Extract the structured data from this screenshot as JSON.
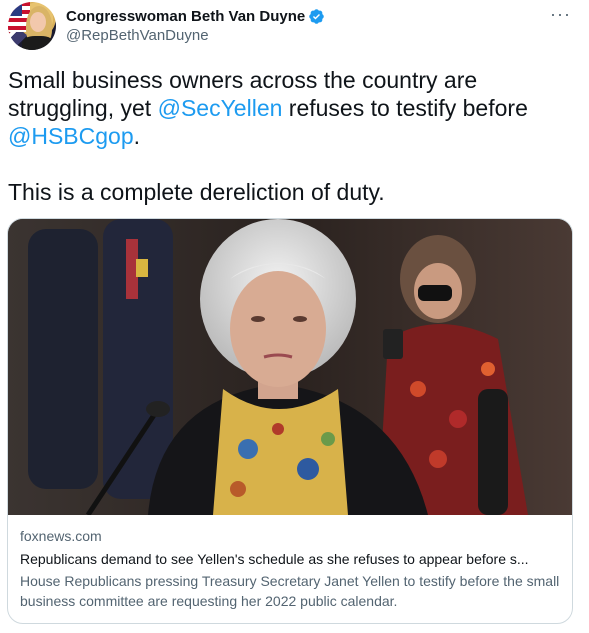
{
  "author": {
    "display_name": "Congresswoman Beth Van Duyne",
    "handle": "@RepBethVanDuyne",
    "verified": true
  },
  "tweet": {
    "line1_pre": "Small business owners across the country are struggling, yet ",
    "mention1": "@SecYellen",
    "line1_post": " refuses to testify before ",
    "mention2": "@HSBCgop",
    "line1_end": ".",
    "line2": "This is a complete dereliction of duty."
  },
  "card": {
    "domain": "foxnews.com",
    "title": "Republicans demand to see Yellen's schedule as she refuses to appear before s...",
    "description": "House Republicans pressing Treasury Secretary Janet Yellen to testify before the small business committee are requesting her 2022 public calendar."
  },
  "menu": {
    "more_label": "···"
  },
  "colors": {
    "accent": "#1d9bf0",
    "text": "#0f1419",
    "secondary": "#536471",
    "border": "#cfd9de"
  },
  "icons": {
    "verified": "verified-badge-icon",
    "more": "more-icon"
  }
}
